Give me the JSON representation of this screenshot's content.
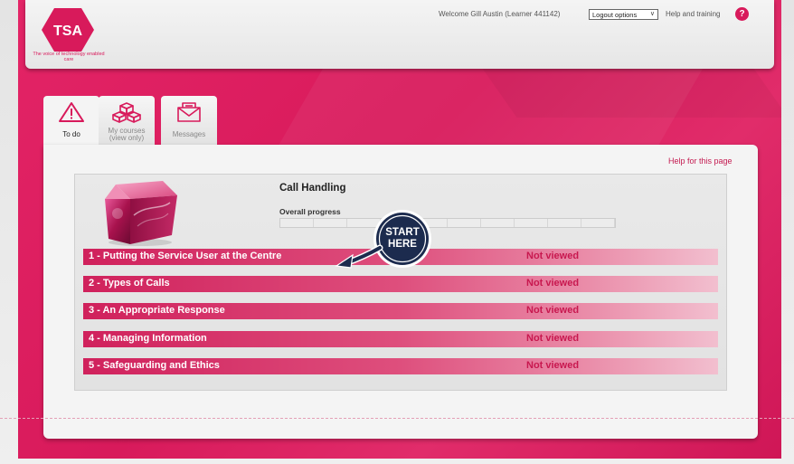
{
  "colors": {
    "brand": "#d81a5b",
    "header_bg": "#efefef",
    "panel_bg": "#f4f4f4",
    "badge_navy": "#1c2b4e"
  },
  "header": {
    "logo_text": "TSA",
    "logo_tagline": "The voice of technology enabled care",
    "welcome_text": "Welcome Gill Austin (Learner 441142)",
    "logout_select_value": "Logout options",
    "help_training_label": "Help and training",
    "help_icon": "question-mark-icon"
  },
  "tabs": [
    {
      "label": "To do",
      "icon": "warning-triangle-icon",
      "active": true
    },
    {
      "label": "My courses\n(view only)",
      "icon": "cubes-icon",
      "active": false
    },
    {
      "label": "Messages",
      "icon": "envelope-icon",
      "active": false
    }
  ],
  "panel": {
    "help_link": "Help for this page"
  },
  "course": {
    "title": "Call Handling",
    "progress_label": "Overall progress",
    "progress_fraction": 0.0,
    "modules": [
      {
        "title": "1 - Putting the Service User at the Centre",
        "status": "Not viewed"
      },
      {
        "title": "2 - Types of Calls",
        "status": "Not viewed"
      },
      {
        "title": "3 - An Appropriate Response",
        "status": "Not viewed"
      },
      {
        "title": "4 - Managing Information",
        "status": "Not viewed"
      },
      {
        "title": "5 - Safeguarding and Ethics",
        "status": "Not viewed"
      }
    ]
  },
  "start_badge": {
    "line1": "START",
    "line2": "HERE"
  }
}
